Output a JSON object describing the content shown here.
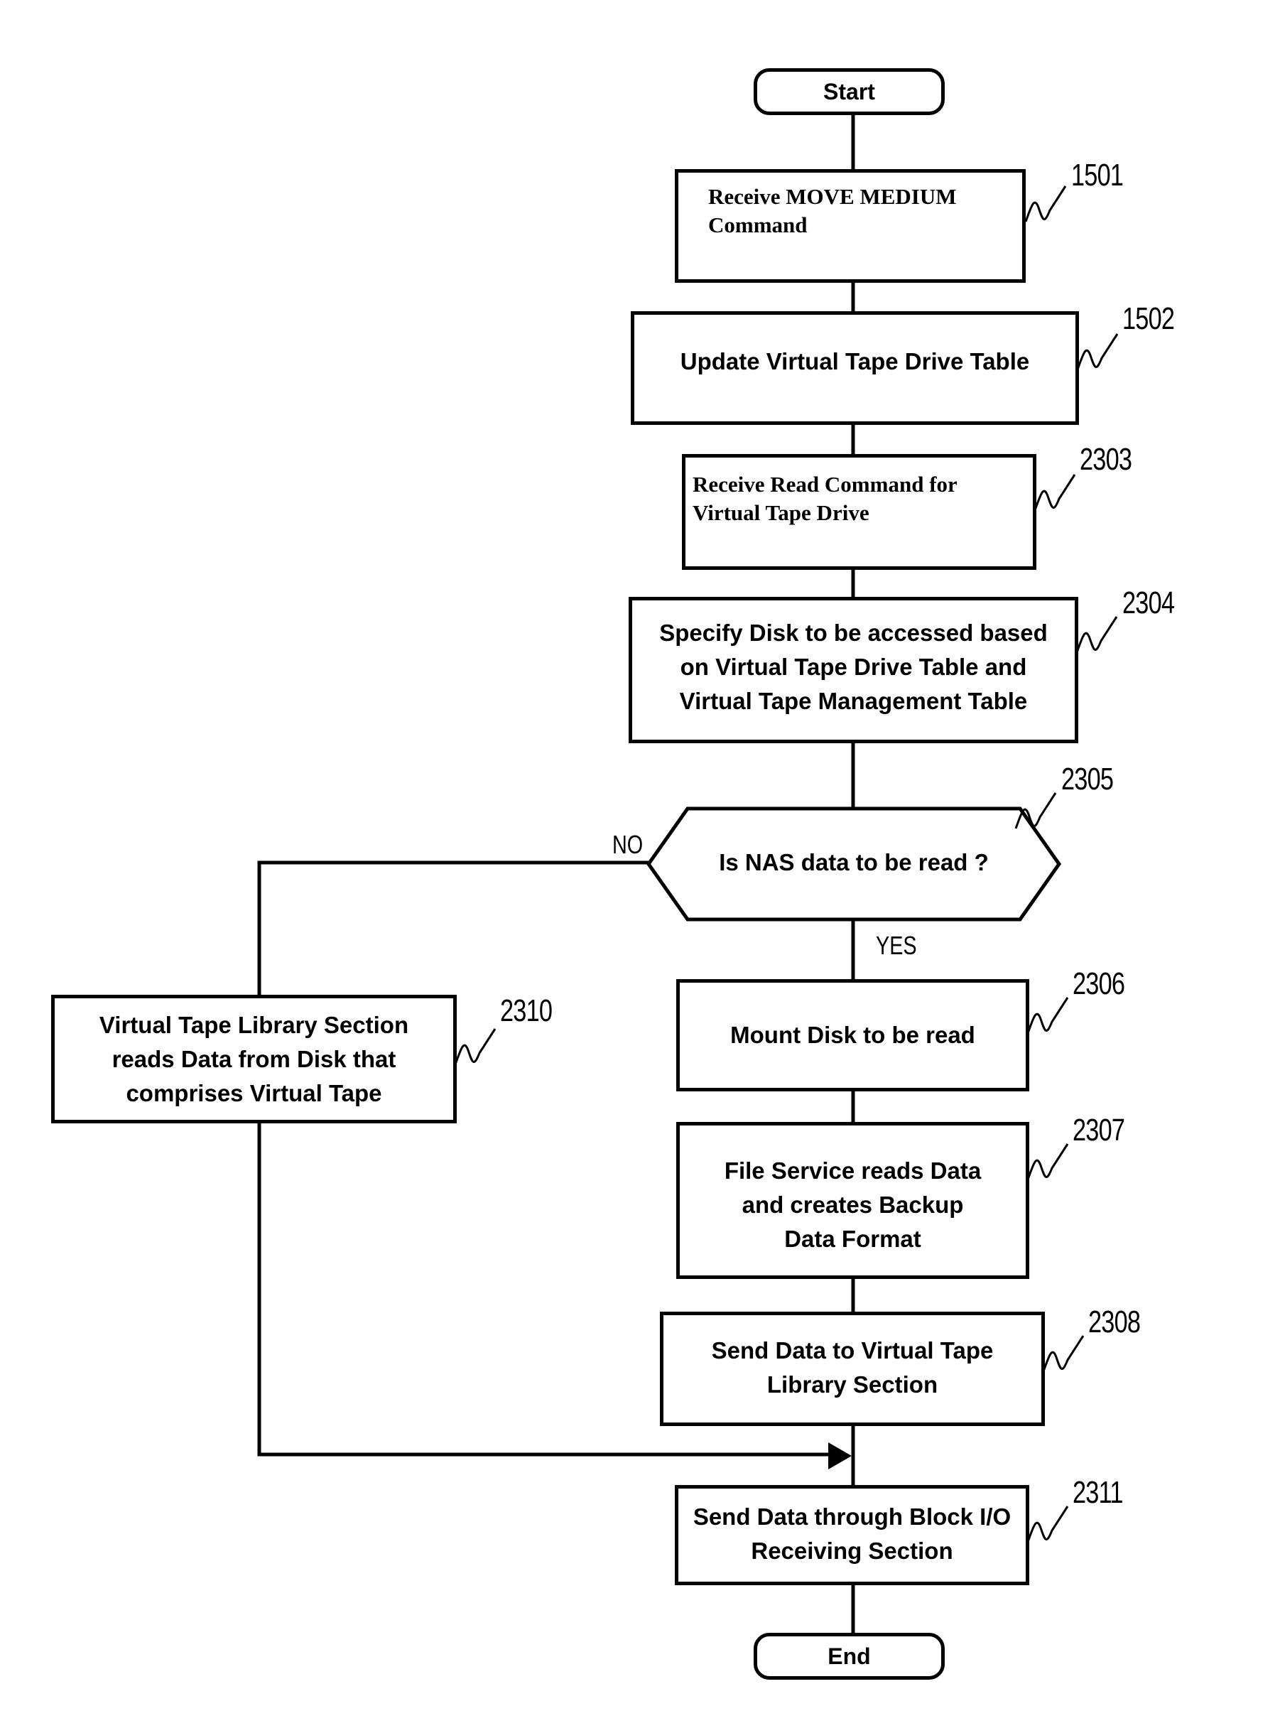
{
  "diagram": {
    "type": "flowchart",
    "start": {
      "label": "Start"
    },
    "end": {
      "label": "End"
    },
    "steps": [
      {
        "id": "1501",
        "ref": "1501",
        "text": "Receive MOVE MEDIUM\nCommand"
      },
      {
        "id": "1502",
        "ref": "1502",
        "text": "Update Virtual Tape Drive Table"
      },
      {
        "id": "2303",
        "ref": "2303",
        "text": "Receive Read Command for\nVirtual Tape Drive"
      },
      {
        "id": "2304",
        "ref": "2304",
        "text": "Specify Disk to be accessed based\non Virtual Tape Drive Table and\nVirtual Tape Management Table"
      },
      {
        "id": "2306",
        "ref": "2306",
        "text": "Mount Disk to be read"
      },
      {
        "id": "2307",
        "ref": "2307",
        "text": "File Service reads Data\nand creates Backup\nData Format"
      },
      {
        "id": "2308",
        "ref": "2308",
        "text": "Send Data to Virtual Tape\nLibrary Section"
      },
      {
        "id": "2310",
        "ref": "2310",
        "text": "Virtual Tape Library Section\nreads Data from Disk that\ncomprises Virtual Tape"
      },
      {
        "id": "2311",
        "ref": "2311",
        "text": "Send Data through Block I/O\nReceiving Section"
      }
    ],
    "decision": {
      "id": "2305",
      "ref": "2305",
      "text": "Is NAS data to be read ?",
      "yes_label": "YES",
      "no_label": "NO"
    },
    "edges": [
      {
        "from": "start",
        "to": "1501"
      },
      {
        "from": "1501",
        "to": "1502"
      },
      {
        "from": "1502",
        "to": "2303"
      },
      {
        "from": "2303",
        "to": "2304"
      },
      {
        "from": "2304",
        "to": "2305"
      },
      {
        "from": "2305",
        "to": "2306",
        "label": "YES"
      },
      {
        "from": "2305",
        "to": "2310",
        "label": "NO"
      },
      {
        "from": "2306",
        "to": "2307"
      },
      {
        "from": "2307",
        "to": "2308"
      },
      {
        "from": "2308",
        "to": "2311"
      },
      {
        "from": "2310",
        "to": "2311"
      },
      {
        "from": "2311",
        "to": "end"
      }
    ]
  }
}
